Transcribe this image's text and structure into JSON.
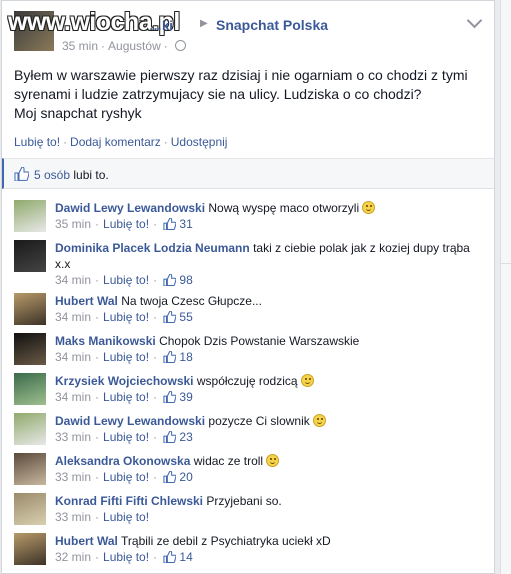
{
  "watermark": "www.wiocha.pl",
  "post": {
    "author_partial": "…ki",
    "group": "Snapchat Polska",
    "time": "35 min",
    "location": "Augustów",
    "text": "Byłem w warszawie pierwszy raz dzisiaj i nie ogarniam o co chodzi z tymi\nsyrenami i ludzie zatrzymujacy sie na ulicy. Ludziska o co chodzi?\nMoj snapchat ryshyk",
    "actions": {
      "like": "Lubię to!",
      "comment": "Dodaj komentarz",
      "share": "Udostępnij"
    },
    "likes": {
      "count": "5 osób",
      "suffix": "lubi to."
    }
  },
  "comments": [
    {
      "name": "Dawid Lewy Lewandowski",
      "text": "Nową wyspę maco otworzyli",
      "emoji": true,
      "time": "35 min",
      "like": "Lubię to!",
      "likes": "31",
      "avatar": [
        "#8faa6b",
        "#e8e8e8"
      ]
    },
    {
      "name": "Dominika Placek Lodzia Neumann",
      "text": "taki z ciebie polak jak z koziej dupy trąba x.x",
      "emoji": false,
      "time": "34 min",
      "like": "Lubię to!",
      "likes": "98",
      "avatar": [
        "#1a1a1a",
        "#444444"
      ],
      "tall": true
    },
    {
      "name": "Hubert Wal",
      "text": "Na twoja Czesc Głupcze...",
      "emoji": false,
      "time": "34 min",
      "like": "Lubię to!",
      "likes": "55",
      "avatar": [
        "#b89a6a",
        "#3d3328"
      ]
    },
    {
      "name": "Maks Manikowski",
      "text": "Chopok Dzis Powstanie Warszawskie",
      "emoji": false,
      "time": "34 min",
      "like": "Lubię to!",
      "likes": "18",
      "avatar": [
        "#111111",
        "#6b5a45"
      ]
    },
    {
      "name": "Krzysiek Wojciechowski",
      "text": "współczuję rodzicą",
      "emoji": true,
      "time": "34 min",
      "like": "Lubię to!",
      "likes": "39",
      "avatar": [
        "#3a6b4a",
        "#9fbf8f"
      ]
    },
    {
      "name": "Dawid Lewy Lewandowski",
      "text": "pozycze Ci slownik",
      "emoji": true,
      "time": "33 min",
      "like": "Lubię to!",
      "likes": "23",
      "avatar": [
        "#8faa6b",
        "#e8e8e8"
      ]
    },
    {
      "name": "Aleksandra Okonowska",
      "text": "widac ze troll",
      "emoji": true,
      "time": "33 min",
      "like": "Lubię to!",
      "likes": "20",
      "avatar": [
        "#5a4a3a",
        "#c9b8a0"
      ]
    },
    {
      "name": "Konrad Fifti Fifti Chlewski",
      "text": "Przyjebani so.",
      "emoji": false,
      "time": "33 min",
      "like": "Lubię to!",
      "likes": "",
      "avatar": [
        "#9a8a6a",
        "#d8d0b0"
      ]
    },
    {
      "name": "Hubert Wal",
      "text": "Trąbili ze debil z Psychiatryka uciekł xD",
      "emoji": false,
      "time": "32 min",
      "like": "Lubię to!",
      "likes": "14",
      "avatar": [
        "#b89a6a",
        "#3d3328"
      ]
    }
  ]
}
